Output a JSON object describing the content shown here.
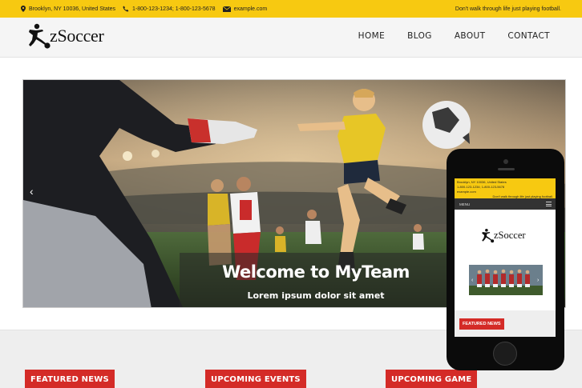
{
  "topbar": {
    "address": "Brooklyn, NY 10036, United States",
    "phones": "1-800-123-1234; 1-800-123-5678",
    "email": "example.com",
    "motto": "Don't walk through life just playing football."
  },
  "header": {
    "logo_text": "zSoccer",
    "nav": [
      "HOME",
      "BLOG",
      "ABOUT",
      "CONTACT"
    ]
  },
  "hero": {
    "title": "Welcome to MyTeam",
    "subtitle": "Lorem ipsum dolor sit amet",
    "prev_icon": "chevron-left-icon"
  },
  "sections": [
    "FEATURED NEWS",
    "UPCOMING EVENTS",
    "UPCOMING GAME"
  ],
  "mobile": {
    "address": "Brooklyn, NY 10036, United States",
    "phones": "1-800-123-1234; 1-800-123-5678",
    "email": "example.com",
    "motto": "Don't walk through life just playing football.",
    "menu_label": "MENU",
    "logo_text": "zSoccer",
    "featured_label": "FEATURED NEWS"
  },
  "colors": {
    "accent_yellow": "#f7c911",
    "accent_red": "#d42b27"
  }
}
